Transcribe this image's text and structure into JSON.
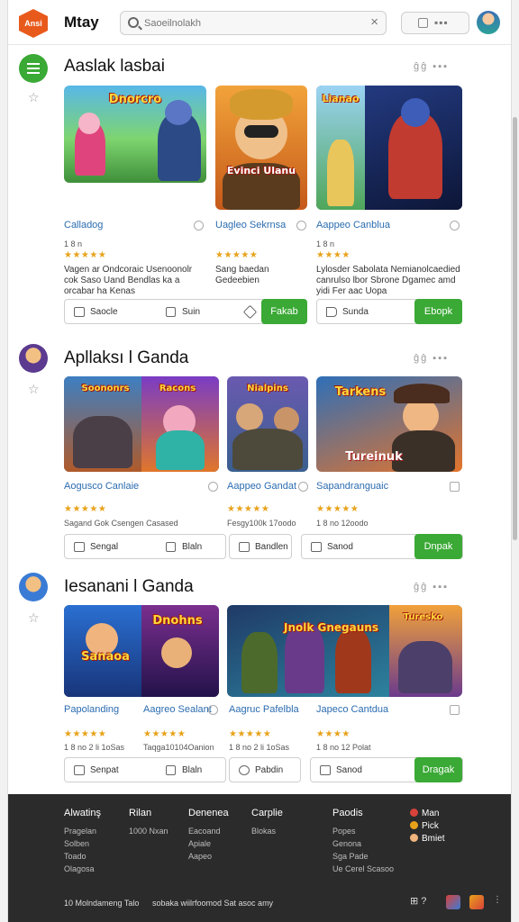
{
  "header": {
    "app_title": "Mtay",
    "search_placeholder": "Saoeilnolakh",
    "search_clear": "×",
    "logo_text": "Ansi"
  },
  "sections": [
    {
      "title": "Aaslak lasbai",
      "tools": "ĝĝ ▪▪▪",
      "cards": [
        {
          "title": "Calladog",
          "meta": "1 8 n",
          "stars": "★★★★★",
          "desc": "Vagen ar Ondcoraic Usenoonolr cok Saso Uand Bendlas ka a orcabar ha Kenas"
        },
        {
          "title": "Uagleo Sekrnsa",
          "meta": "",
          "stars": "★★★★★",
          "desc": "Sang baedan Gedeebien"
        },
        {
          "title": "Aappeo Canblua",
          "meta": "1 8 n",
          "stars": "★★★★",
          "desc": "Lylosder Sabolata Nemianolcaedied canrulso lbor Sbrone Dgamec amd yidi Fer aac Uopa"
        }
      ],
      "actions": [
        "Saocle",
        "Suin",
        "Fakab",
        "Sunda",
        "Ebopk"
      ]
    },
    {
      "title": "Apllaksı l Ganda",
      "tools": "ĝĝ ▪▪▪",
      "cards": [
        {
          "title": "Aogusco Canlaie",
          "meta": "Sagand Gok Csengen Casased",
          "stars": "★★★★★"
        },
        {
          "title": "Aappeo Gandat",
          "meta": "Fesgy100k 17oodo",
          "stars": "★★★★★"
        },
        {
          "title": "Sapandranguaic",
          "meta": "1 8 no 12oodo",
          "stars": "★★★★★"
        }
      ],
      "actions": [
        "Sengal",
        "Blaln",
        "Bandlen",
        "Sanod",
        "Dnpak"
      ]
    },
    {
      "title": "Iesanani l Ganda",
      "tools": "ĝĝ ▪▪▪",
      "cards": [
        {
          "title": "Papolanding",
          "meta": "1 8 no 2 li 1oSas",
          "stars": "★★★★★"
        },
        {
          "title": "Aagreo Sealant",
          "meta": "Taqga10104Oanion",
          "stars": "★★★★★"
        },
        {
          "title": "Aagruc Pafelbla",
          "meta": "1 8 no 2 li 1oSas",
          "stars": "★★★★★"
        },
        {
          "title": "Japeco Cantdua",
          "meta": "1 8 no 12 Polat",
          "stars": "★★★★"
        }
      ],
      "actions": [
        "Senpat",
        "Blaln",
        "Pabdin",
        "Sanod",
        "Dragak"
      ]
    }
  ],
  "game_art": [
    "Dnorcro",
    "Evinci Ulanu",
    "Lianao",
    "Soononrs",
    "Racons",
    "Nialpins",
    "Tarkens",
    "Tureinuk",
    "Sanaoa",
    "Dnohns",
    "Jnolk Gnegauns",
    "Turesko"
  ],
  "footer": {
    "columns": [
      {
        "head": "Alwatinş",
        "items": [
          "Pragelan",
          "Solben",
          "Toado",
          "Olagosa"
        ]
      },
      {
        "head": "Rilan",
        "items": [
          "1000 Nxan"
        ]
      },
      {
        "head": "Denenea",
        "items": [
          "Eacoand",
          "Apiale",
          "Aapeo"
        ]
      },
      {
        "head": "Carplie",
        "items": [
          "Blokas"
        ]
      },
      {
        "head": "Paodis",
        "items": [
          "Popes",
          "Genona",
          "Sga Pade",
          "Ue Cerel Scasoo"
        ]
      }
    ],
    "social": [
      "Man",
      "Pick",
      "Bmiet"
    ],
    "bottom_left": "10 Molndameng Talo",
    "bottom_mid": "sobaka wiilrfoomod Sat asoc amy",
    "bottom_icons": "⊞ ?"
  },
  "colors": {
    "accent_green": "#3aa935",
    "link_blue": "#2b6cb0",
    "star": "#e8a21a",
    "footer_bg": "#2b2b2b",
    "logo": "#e85a1c"
  }
}
